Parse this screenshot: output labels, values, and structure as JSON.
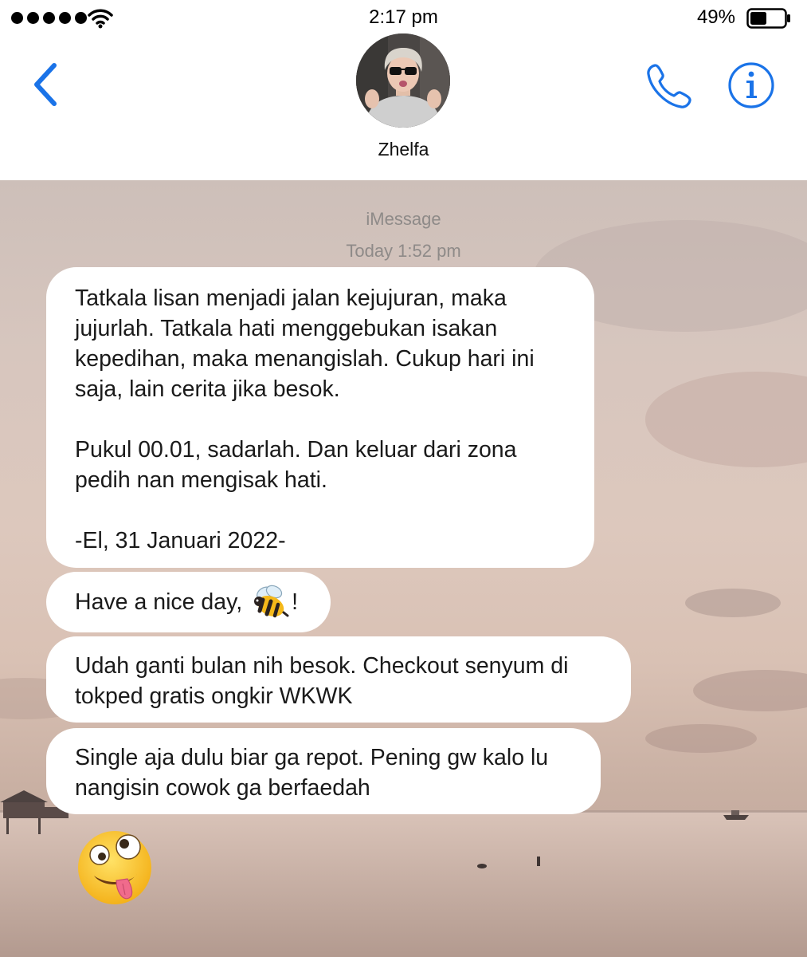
{
  "status_bar": {
    "time": "2:17 pm",
    "battery_percent": "49%",
    "battery_level": 0.49,
    "signal_bars": 5
  },
  "header": {
    "contact_name": "Zhelfa",
    "accent_color": "#1a73e8"
  },
  "conversation": {
    "service_label": "iMessage",
    "timestamp": "Today 1:52 pm",
    "messages": [
      {
        "text": "Tatkala lisan menjadi jalan kejujuran, maka\njujurlah. Tatkala hati menggebukan isakan\nkepedihan, maka menangislah. Cukup hari ini\nsaja, lain cerita jika besok.\n\nPukul 00.01, sadarlah. Dan keluar dari zona\npedih nan mengisak hati.\n\n-El, 31 Januari 2022-"
      },
      {
        "text_before": "Have a nice day, ",
        "emoji": "bee-emoji",
        "text_after": "!"
      },
      {
        "text": "Udah ganti bulan nih besok. Checkout senyum di\ntokped gratis ongkir WKWK"
      },
      {
        "text": "Single aja dulu biar ga repot. Pening gw kalo lu\nnangisin cowok ga berfaedah"
      }
    ],
    "last_message_emoji": "zany-face-emoji"
  }
}
